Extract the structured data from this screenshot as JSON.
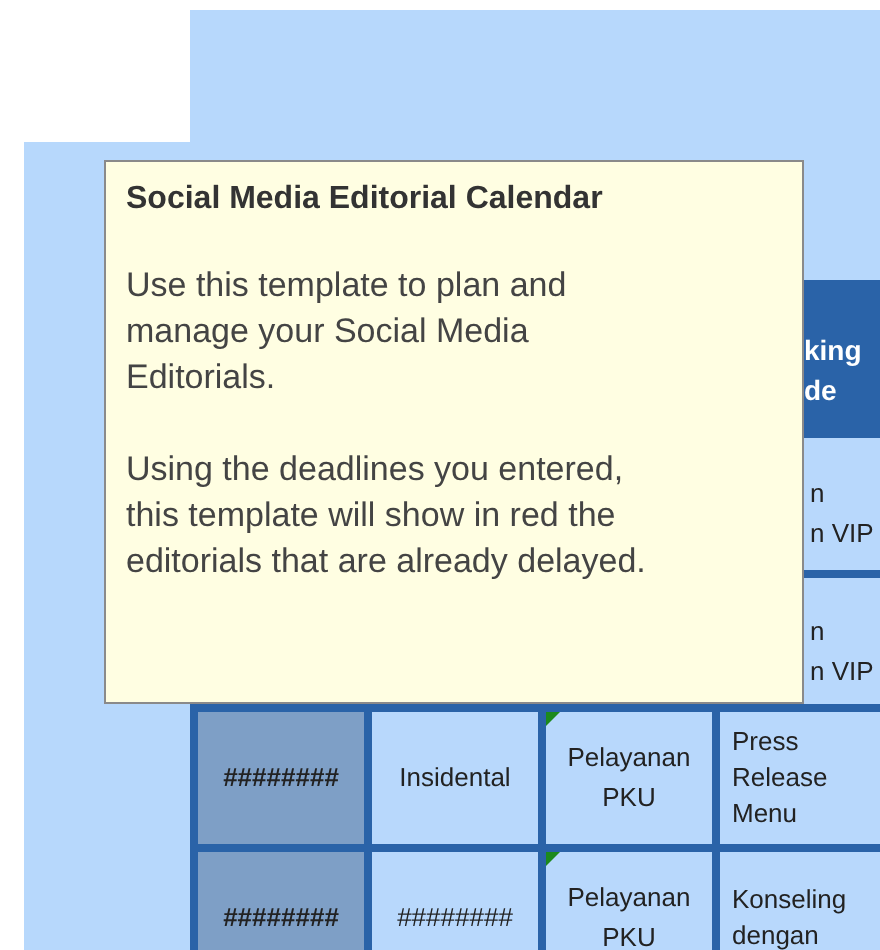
{
  "tooltip": {
    "title": "Social Media Editorial Calendar",
    "paragraphs": [
      "Use this template to plan and manage your Social Media Editorials.",
      "Using the deadlines you entered, this template will show in red the editorials that are already delayed."
    ]
  },
  "table": {
    "header_column_4": [
      "king",
      "de"
    ],
    "rows": [
      {
        "column_4": [
          "n",
          "n VIP"
        ]
      },
      {
        "column_4": [
          "n",
          "n VIP"
        ]
      },
      {
        "column_1": "########",
        "column_2": "Insidental",
        "column_3": "Pelayanan PKU",
        "column_3_commented": true,
        "column_4": [
          "Press",
          "Release",
          "Menu"
        ]
      },
      {
        "column_1": "########",
        "column_2": "########",
        "column_3": "Pelayanan PKU",
        "column_3_commented": true,
        "column_4": [
          "Konseling",
          "dengan"
        ]
      }
    ]
  }
}
